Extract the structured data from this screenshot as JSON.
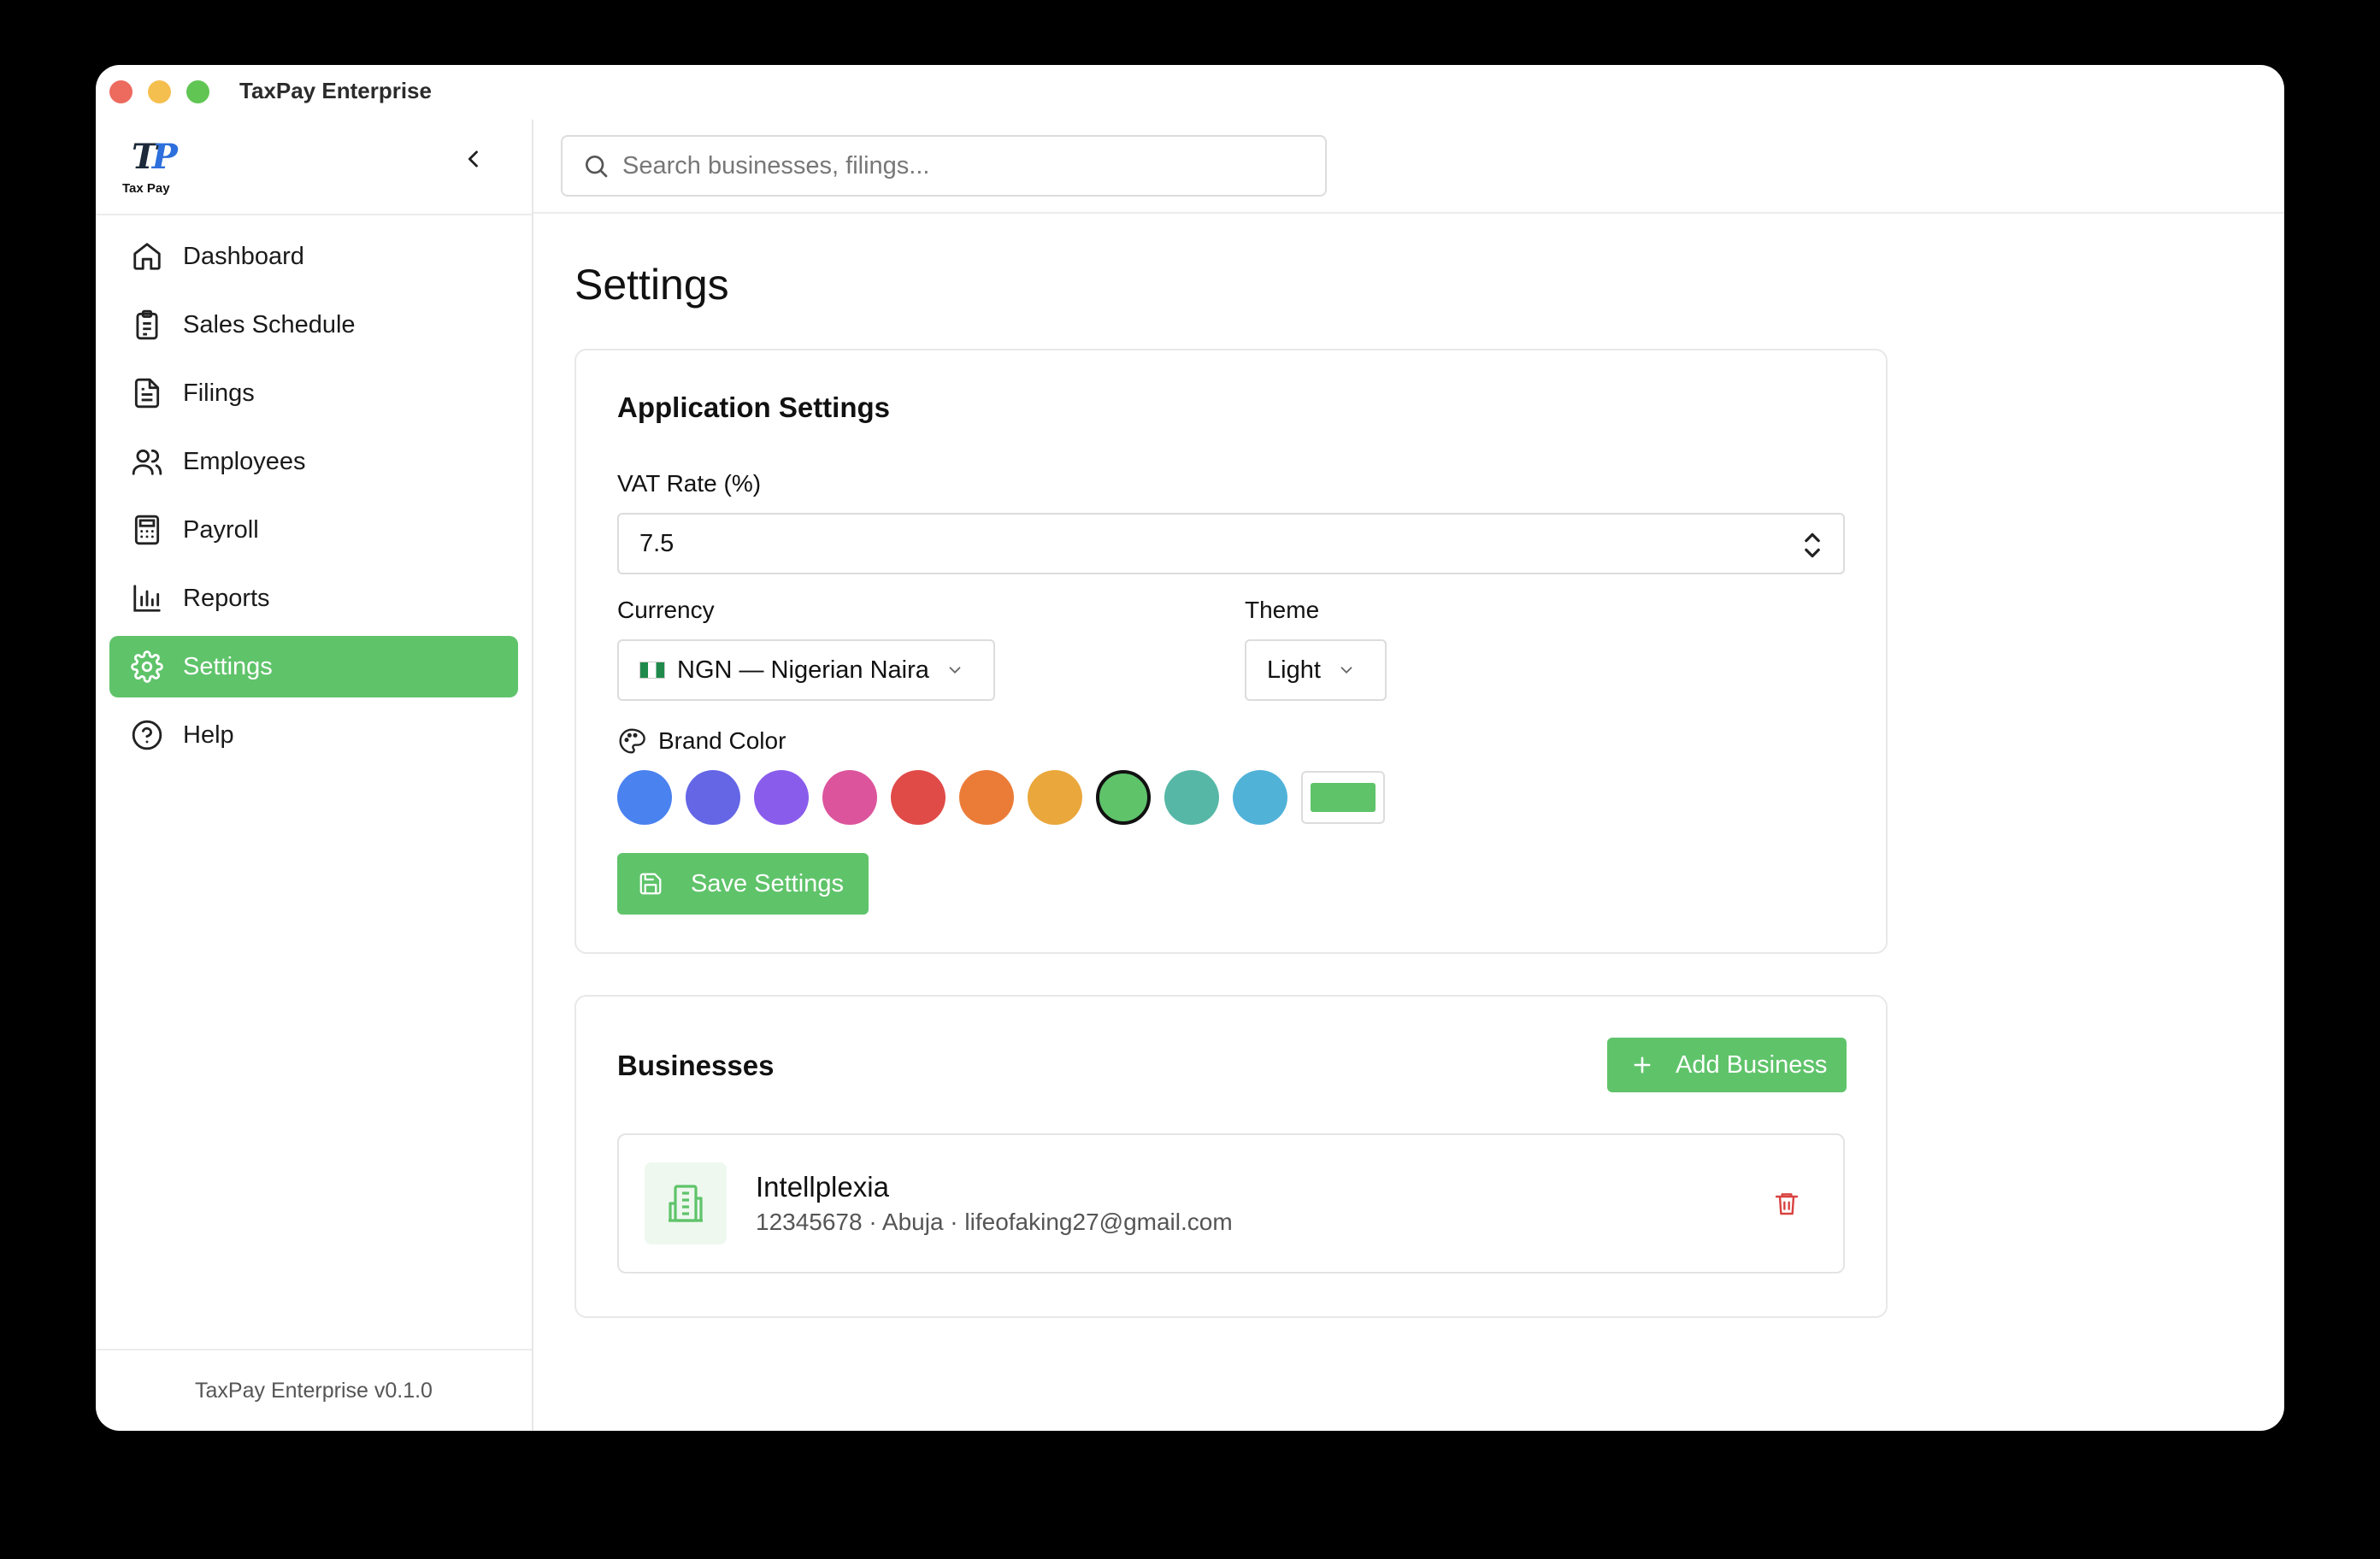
{
  "window": {
    "title": "TaxPay Enterprise"
  },
  "brand": {
    "mark_t": "T",
    "mark_p": "P",
    "name": "Tax Pay"
  },
  "search": {
    "placeholder": "Search businesses, filings..."
  },
  "sidebar": {
    "items": [
      {
        "label": "Dashboard",
        "icon": "home-icon",
        "active": false
      },
      {
        "label": "Sales Schedule",
        "icon": "clipboard-icon",
        "active": false
      },
      {
        "label": "Filings",
        "icon": "document-icon",
        "active": false
      },
      {
        "label": "Employees",
        "icon": "users-icon",
        "active": false
      },
      {
        "label": "Payroll",
        "icon": "calculator-icon",
        "active": false
      },
      {
        "label": "Reports",
        "icon": "bar-chart-icon",
        "active": false
      },
      {
        "label": "Settings",
        "icon": "gear-icon",
        "active": true
      },
      {
        "label": "Help",
        "icon": "help-circle-icon",
        "active": false
      }
    ],
    "footer": "TaxPay Enterprise v0.1.0"
  },
  "page": {
    "title": "Settings"
  },
  "app_settings": {
    "title": "Application Settings",
    "vat_label": "VAT Rate (%)",
    "vat_value": "7.5",
    "currency_label": "Currency",
    "currency_value": "NGN — Nigerian Naira",
    "theme_label": "Theme",
    "theme_value": "Light",
    "brand_color_label": "Brand Color",
    "swatches": [
      "#4a82f0",
      "#6466e6",
      "#8a5cec",
      "#dc559c",
      "#e04b48",
      "#eb7c38",
      "#eaa73b",
      "#5fc36a",
      "#57b7a6",
      "#51b2d8"
    ],
    "selected_color": "#5fc36a",
    "save_label": "Save Settings"
  },
  "businesses": {
    "title": "Businesses",
    "add_label": "Add Business",
    "items": [
      {
        "name": "Intellplexia",
        "meta": "12345678 · Abuja · lifeofaking27@gmail.com"
      }
    ]
  },
  "colors": {
    "accent": "#5fc36a",
    "danger": "#d9423f"
  }
}
